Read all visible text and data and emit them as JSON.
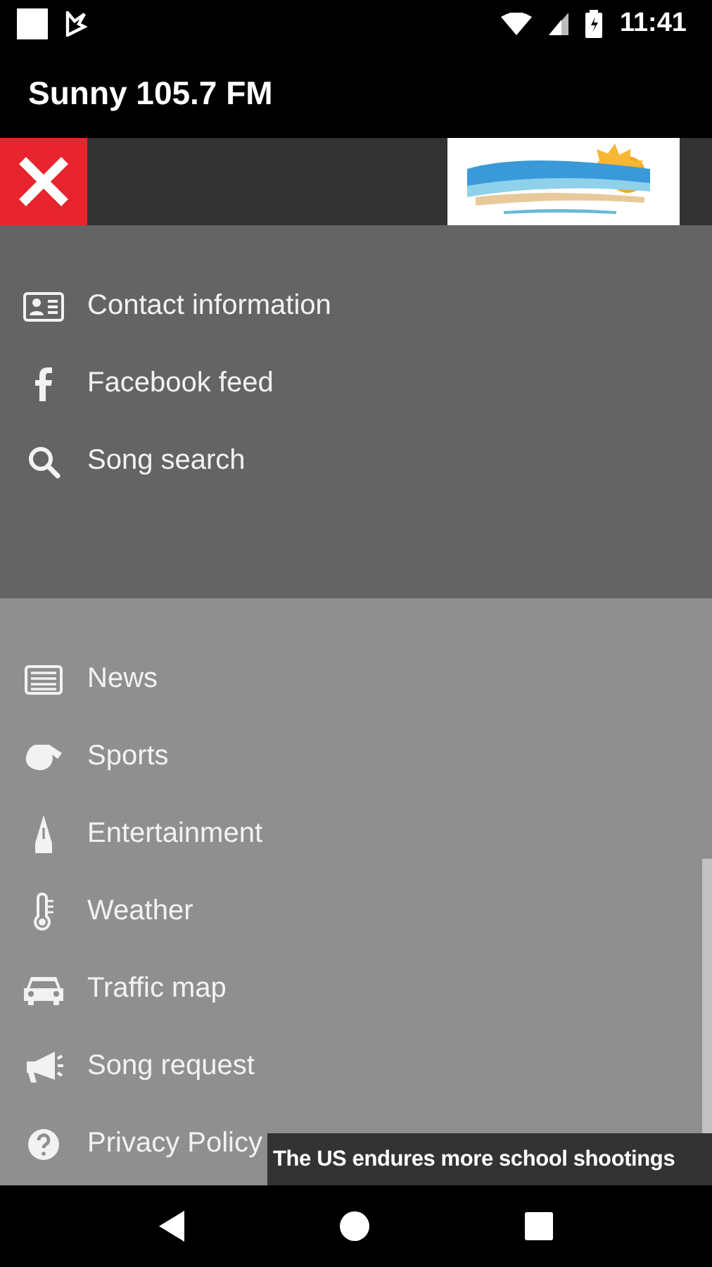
{
  "status_bar": {
    "time": "11:41"
  },
  "app_bar": {
    "title": "Sunny 105.7 FM"
  },
  "menu_sections": [
    {
      "items": [
        {
          "label": "Contact information"
        },
        {
          "label": "Facebook feed"
        },
        {
          "label": "Song search"
        }
      ]
    },
    {
      "items": [
        {
          "label": "News"
        },
        {
          "label": "Sports"
        },
        {
          "label": "Entertainment"
        },
        {
          "label": "Weather"
        },
        {
          "label": "Traffic map"
        },
        {
          "label": "Song request"
        },
        {
          "label": "Privacy Policy"
        }
      ]
    }
  ],
  "ticker": {
    "text": "The US endures more school shootings"
  }
}
